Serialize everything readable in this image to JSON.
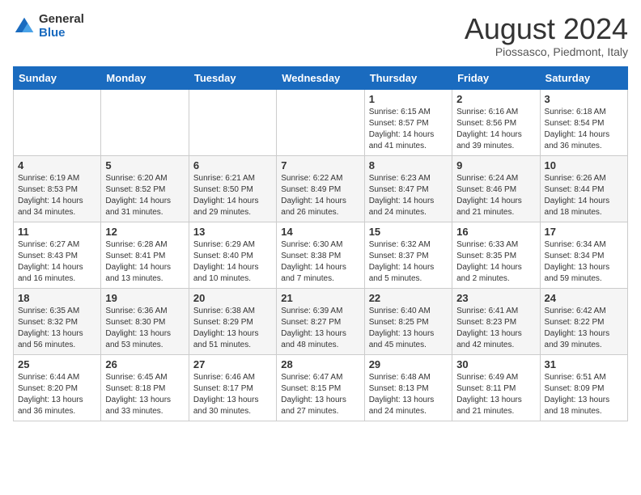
{
  "header": {
    "logo_general": "General",
    "logo_blue": "Blue",
    "title": "August 2024",
    "subtitle": "Piossasco, Piedmont, Italy"
  },
  "calendar": {
    "days_of_week": [
      "Sunday",
      "Monday",
      "Tuesday",
      "Wednesday",
      "Thursday",
      "Friday",
      "Saturday"
    ],
    "weeks": [
      [
        {
          "day": "",
          "info": ""
        },
        {
          "day": "",
          "info": ""
        },
        {
          "day": "",
          "info": ""
        },
        {
          "day": "",
          "info": ""
        },
        {
          "day": "1",
          "info": "Sunrise: 6:15 AM\nSunset: 8:57 PM\nDaylight: 14 hours and 41 minutes."
        },
        {
          "day": "2",
          "info": "Sunrise: 6:16 AM\nSunset: 8:56 PM\nDaylight: 14 hours and 39 minutes."
        },
        {
          "day": "3",
          "info": "Sunrise: 6:18 AM\nSunset: 8:54 PM\nDaylight: 14 hours and 36 minutes."
        }
      ],
      [
        {
          "day": "4",
          "info": "Sunrise: 6:19 AM\nSunset: 8:53 PM\nDaylight: 14 hours and 34 minutes."
        },
        {
          "day": "5",
          "info": "Sunrise: 6:20 AM\nSunset: 8:52 PM\nDaylight: 14 hours and 31 minutes."
        },
        {
          "day": "6",
          "info": "Sunrise: 6:21 AM\nSunset: 8:50 PM\nDaylight: 14 hours and 29 minutes."
        },
        {
          "day": "7",
          "info": "Sunrise: 6:22 AM\nSunset: 8:49 PM\nDaylight: 14 hours and 26 minutes."
        },
        {
          "day": "8",
          "info": "Sunrise: 6:23 AM\nSunset: 8:47 PM\nDaylight: 14 hours and 24 minutes."
        },
        {
          "day": "9",
          "info": "Sunrise: 6:24 AM\nSunset: 8:46 PM\nDaylight: 14 hours and 21 minutes."
        },
        {
          "day": "10",
          "info": "Sunrise: 6:26 AM\nSunset: 8:44 PM\nDaylight: 14 hours and 18 minutes."
        }
      ],
      [
        {
          "day": "11",
          "info": "Sunrise: 6:27 AM\nSunset: 8:43 PM\nDaylight: 14 hours and 16 minutes."
        },
        {
          "day": "12",
          "info": "Sunrise: 6:28 AM\nSunset: 8:41 PM\nDaylight: 14 hours and 13 minutes."
        },
        {
          "day": "13",
          "info": "Sunrise: 6:29 AM\nSunset: 8:40 PM\nDaylight: 14 hours and 10 minutes."
        },
        {
          "day": "14",
          "info": "Sunrise: 6:30 AM\nSunset: 8:38 PM\nDaylight: 14 hours and 7 minutes."
        },
        {
          "day": "15",
          "info": "Sunrise: 6:32 AM\nSunset: 8:37 PM\nDaylight: 14 hours and 5 minutes."
        },
        {
          "day": "16",
          "info": "Sunrise: 6:33 AM\nSunset: 8:35 PM\nDaylight: 14 hours and 2 minutes."
        },
        {
          "day": "17",
          "info": "Sunrise: 6:34 AM\nSunset: 8:34 PM\nDaylight: 13 hours and 59 minutes."
        }
      ],
      [
        {
          "day": "18",
          "info": "Sunrise: 6:35 AM\nSunset: 8:32 PM\nDaylight: 13 hours and 56 minutes."
        },
        {
          "day": "19",
          "info": "Sunrise: 6:36 AM\nSunset: 8:30 PM\nDaylight: 13 hours and 53 minutes."
        },
        {
          "day": "20",
          "info": "Sunrise: 6:38 AM\nSunset: 8:29 PM\nDaylight: 13 hours and 51 minutes."
        },
        {
          "day": "21",
          "info": "Sunrise: 6:39 AM\nSunset: 8:27 PM\nDaylight: 13 hours and 48 minutes."
        },
        {
          "day": "22",
          "info": "Sunrise: 6:40 AM\nSunset: 8:25 PM\nDaylight: 13 hours and 45 minutes."
        },
        {
          "day": "23",
          "info": "Sunrise: 6:41 AM\nSunset: 8:23 PM\nDaylight: 13 hours and 42 minutes."
        },
        {
          "day": "24",
          "info": "Sunrise: 6:42 AM\nSunset: 8:22 PM\nDaylight: 13 hours and 39 minutes."
        }
      ],
      [
        {
          "day": "25",
          "info": "Sunrise: 6:44 AM\nSunset: 8:20 PM\nDaylight: 13 hours and 36 minutes."
        },
        {
          "day": "26",
          "info": "Sunrise: 6:45 AM\nSunset: 8:18 PM\nDaylight: 13 hours and 33 minutes."
        },
        {
          "day": "27",
          "info": "Sunrise: 6:46 AM\nSunset: 8:17 PM\nDaylight: 13 hours and 30 minutes."
        },
        {
          "day": "28",
          "info": "Sunrise: 6:47 AM\nSunset: 8:15 PM\nDaylight: 13 hours and 27 minutes."
        },
        {
          "day": "29",
          "info": "Sunrise: 6:48 AM\nSunset: 8:13 PM\nDaylight: 13 hours and 24 minutes."
        },
        {
          "day": "30",
          "info": "Sunrise: 6:49 AM\nSunset: 8:11 PM\nDaylight: 13 hours and 21 minutes."
        },
        {
          "day": "31",
          "info": "Sunrise: 6:51 AM\nSunset: 8:09 PM\nDaylight: 13 hours and 18 minutes."
        }
      ]
    ]
  }
}
